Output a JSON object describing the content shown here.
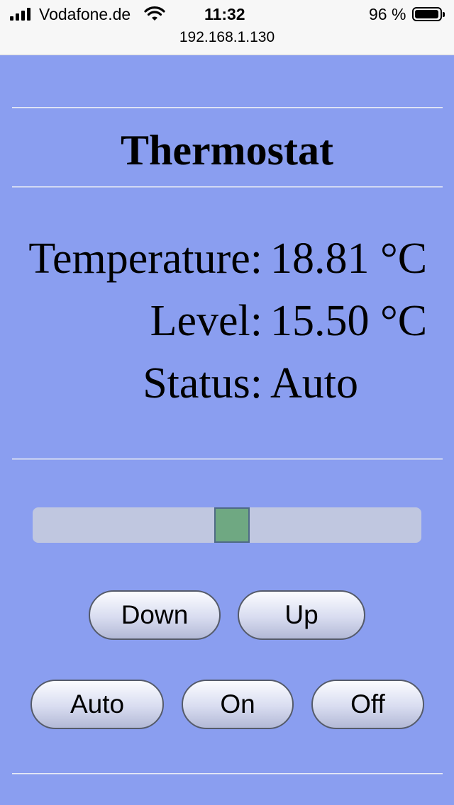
{
  "statusbar": {
    "carrier": "Vodafone.de",
    "time": "11:32",
    "battery_percent": "96 %",
    "battery_level": 0.96,
    "url": "192.168.1.130",
    "icons": [
      "signal-icon",
      "wifi-icon",
      "battery-icon"
    ]
  },
  "page": {
    "title": "Thermostat"
  },
  "readings": {
    "temperature_label": "Temperature:",
    "temperature_value": "18.81 °C",
    "level_label": "Level:",
    "level_value": "15.50 °C",
    "status_label": "Status:",
    "status_value": "Auto"
  },
  "slider": {
    "value_fraction": 0.5
  },
  "buttons": {
    "down": "Down",
    "up": "Up",
    "auto": "Auto",
    "on": "On",
    "off": "Off"
  },
  "colors": {
    "background": "#8a9ef0",
    "slider_track": "#c0c7e0",
    "slider_thumb": "#6fa882"
  }
}
